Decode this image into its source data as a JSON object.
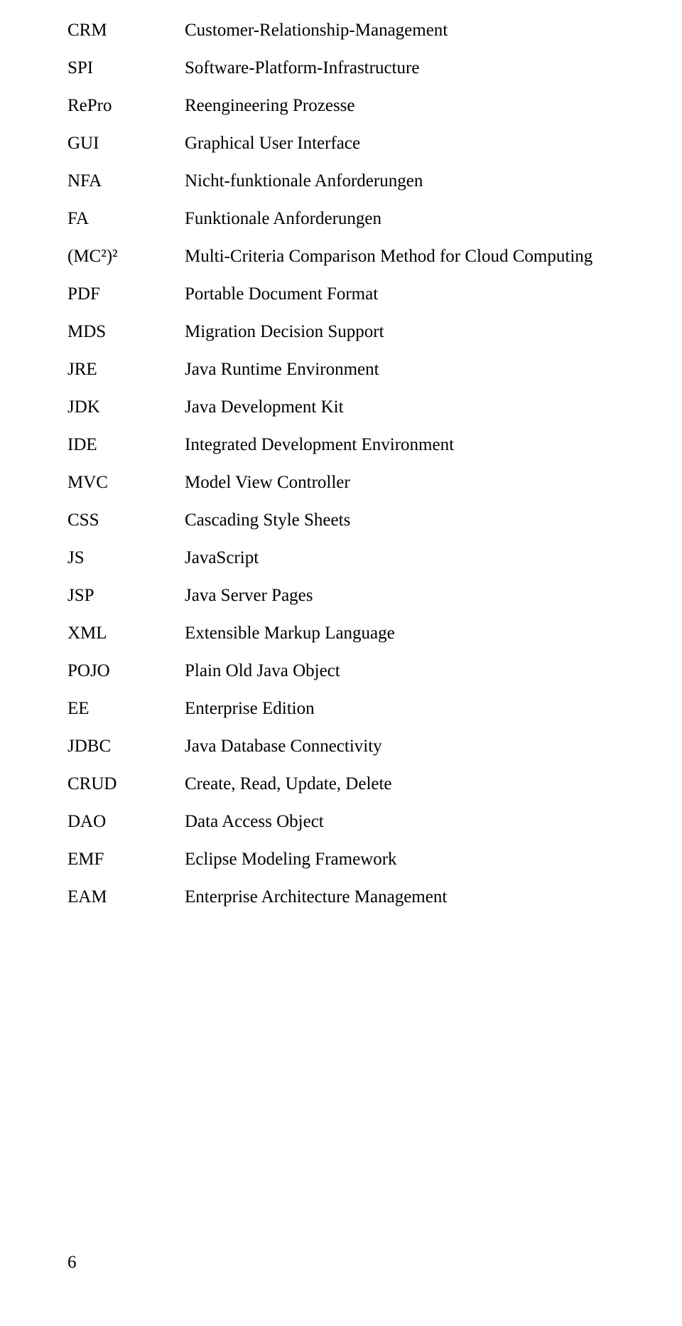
{
  "glossary": [
    {
      "abbr": "CRM",
      "def": "Customer-Relationship-Management"
    },
    {
      "abbr": "SPI",
      "def": "Software-Platform-Infrastructure"
    },
    {
      "abbr": "RePro",
      "def": "Reengineering Prozesse"
    },
    {
      "abbr": "GUI",
      "def": "Graphical User Interface"
    },
    {
      "abbr": "NFA",
      "def": "Nicht-funktionale Anforderungen"
    },
    {
      "abbr": "FA",
      "def": "Funktionale Anforderungen"
    },
    {
      "abbr": "(MC²)²",
      "def": "Multi-Criteria Comparison Method for Cloud Computing"
    },
    {
      "abbr": "PDF",
      "def": "Portable Document Format"
    },
    {
      "abbr": "MDS",
      "def": "Migration Decision Support"
    },
    {
      "abbr": "JRE",
      "def": "Java Runtime Environment"
    },
    {
      "abbr": "JDK",
      "def": "Java Development Kit"
    },
    {
      "abbr": "IDE",
      "def": "Integrated Development Environment"
    },
    {
      "abbr": "MVC",
      "def": "Model View Controller"
    },
    {
      "abbr": "CSS",
      "def": "Cascading Style Sheets"
    },
    {
      "abbr": "JS",
      "def": "JavaScript"
    },
    {
      "abbr": "JSP",
      "def": "Java Server Pages"
    },
    {
      "abbr": "XML",
      "def": "Extensible Markup Language"
    },
    {
      "abbr": "POJO",
      "def": "Plain Old Java Object"
    },
    {
      "abbr": "EE",
      "def": "Enterprise Edition"
    },
    {
      "abbr": "JDBC",
      "def": "Java Database Connectivity"
    },
    {
      "abbr": "CRUD",
      "def": "Create, Read, Update, Delete"
    },
    {
      "abbr": "DAO",
      "def": "Data Access Object"
    },
    {
      "abbr": "EMF",
      "def": "Eclipse Modeling Framework"
    },
    {
      "abbr": "EAM",
      "def": "Enterprise Architecture Management"
    }
  ],
  "page_number": "6"
}
